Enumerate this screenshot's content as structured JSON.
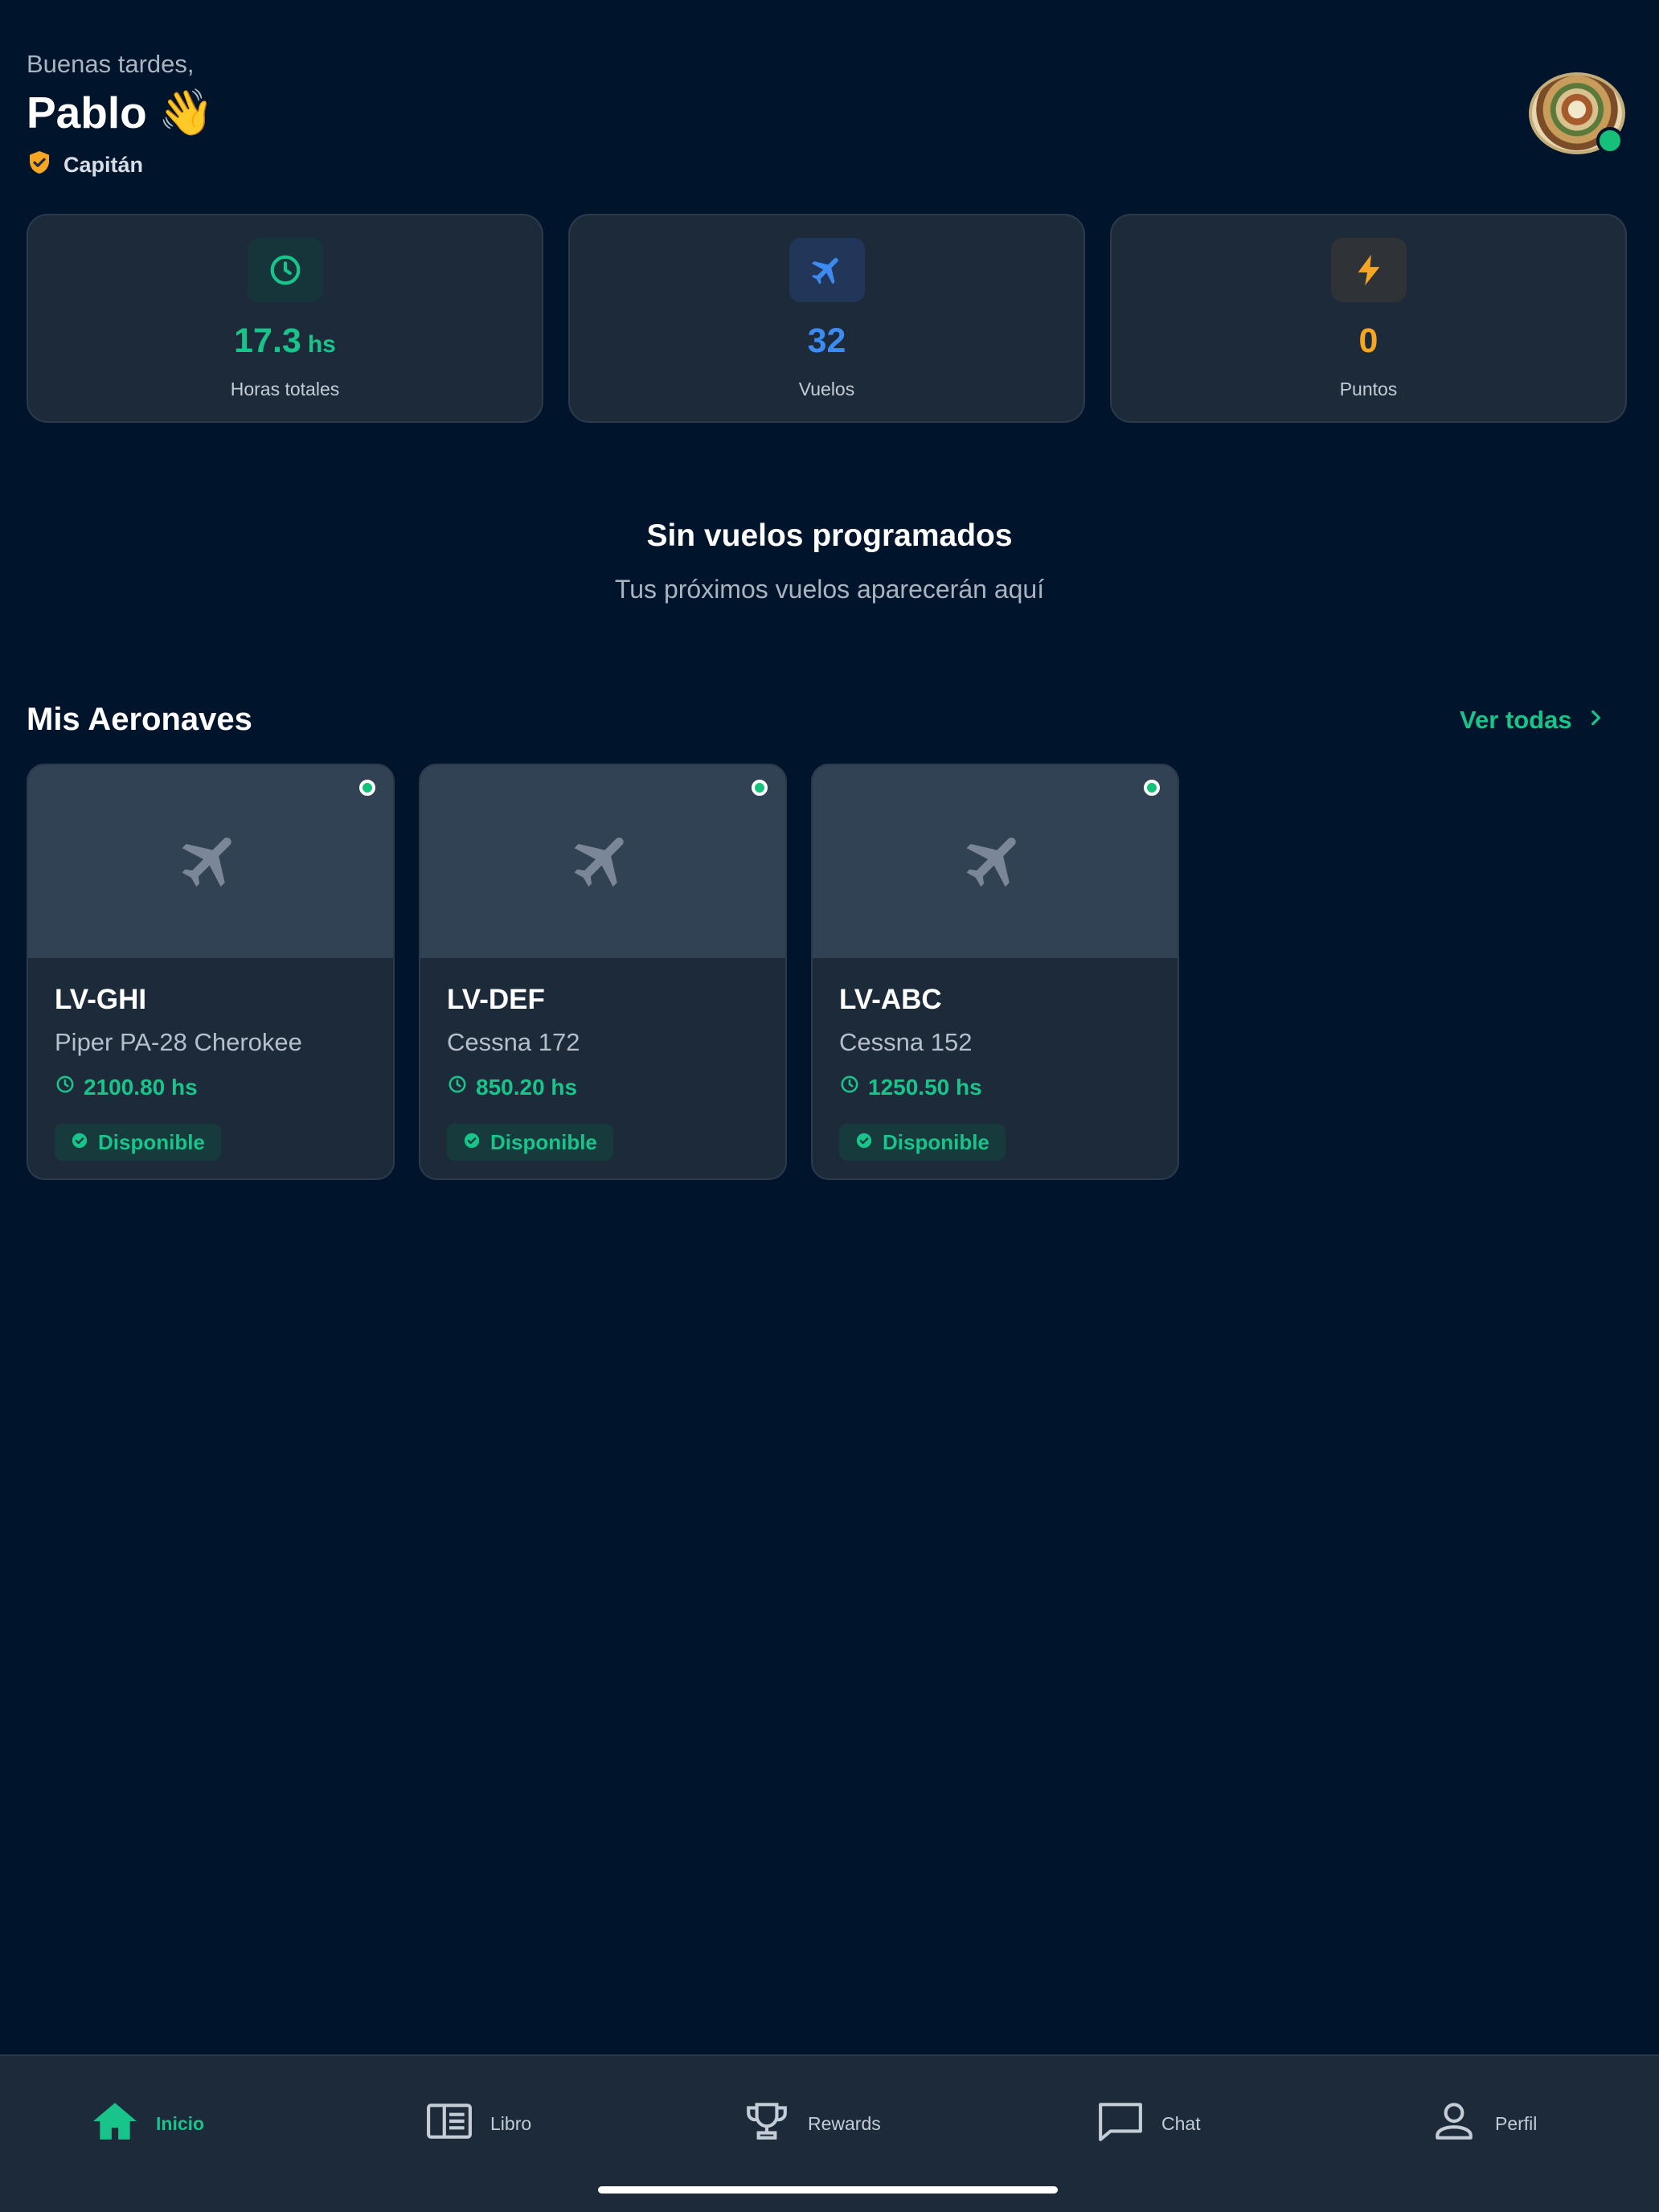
{
  "header": {
    "greeting": "Buenas tardes,",
    "user_name": "Pablo",
    "wave_emoji": "👋",
    "rank": "Capitán",
    "rank_icon": "shield-check-icon",
    "avatar_status": "online"
  },
  "stats": [
    {
      "value": "17.3",
      "unit": "hs",
      "label": "Horas totales",
      "icon": "clock-icon",
      "color": "#19c48a"
    },
    {
      "value": "32",
      "unit": "",
      "label": "Vuelos",
      "icon": "airplane-icon",
      "color": "#3d8bf0"
    },
    {
      "value": "0",
      "unit": "",
      "label": "Puntos",
      "icon": "lightning-icon",
      "color": "#f5a623"
    }
  ],
  "empty_state": {
    "title": "Sin vuelos programados",
    "subtitle": "Tus próximos vuelos aparecerán aquí"
  },
  "aircraft_section": {
    "title": "Mis Aeronaves",
    "see_all": "Ver todas",
    "items": [
      {
        "registration": "LV-GHI",
        "model": "Piper PA-28 Cherokee",
        "hours": "2100.80 hs",
        "status": "Disponible"
      },
      {
        "registration": "LV-DEF",
        "model": "Cessna 172",
        "hours": "850.20 hs",
        "status": "Disponible"
      },
      {
        "registration": "LV-ABC",
        "model": "Cessna 152",
        "hours": "1250.50 hs",
        "status": "Disponible"
      }
    ]
  },
  "bottom_nav": {
    "items": [
      {
        "label": "Inicio",
        "icon": "home-icon",
        "active": true
      },
      {
        "label": "Libro",
        "icon": "logbook-icon",
        "active": false
      },
      {
        "label": "Rewards",
        "icon": "trophy-icon",
        "active": false
      },
      {
        "label": "Chat",
        "icon": "chat-bubble-icon",
        "active": false
      },
      {
        "label": "Perfil",
        "icon": "person-icon",
        "active": false
      }
    ]
  },
  "colors": {
    "background": "#00152b",
    "card": "#1d2a3a",
    "accent_green": "#19c48a",
    "accent_blue": "#3d8bf0",
    "accent_orange": "#f5a623"
  }
}
